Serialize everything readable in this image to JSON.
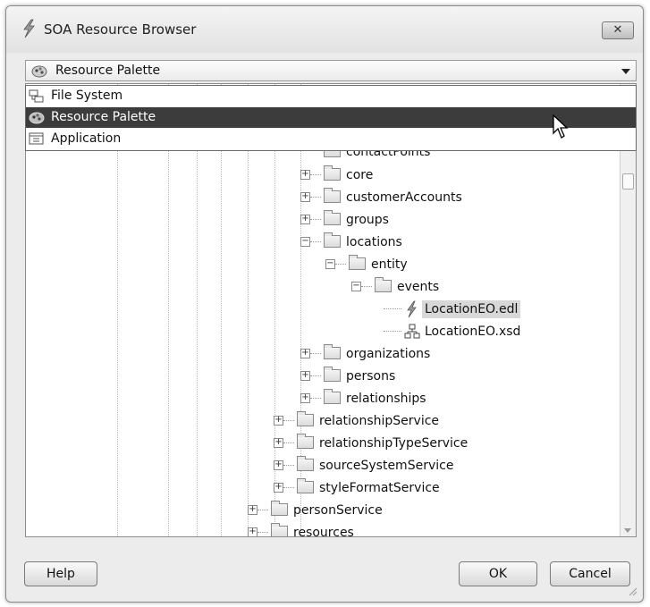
{
  "window": {
    "title": "SOA Resource Browser",
    "close_glyph": "✕"
  },
  "combo": {
    "selected": "Resource Palette"
  },
  "dropdown": {
    "options": [
      {
        "label": "File System",
        "icon": "file-system-icon"
      },
      {
        "label": "Resource Palette",
        "icon": "resource-palette-icon",
        "active": true
      },
      {
        "label": "Application",
        "icon": "application-icon"
      }
    ]
  },
  "tree": {
    "partial_top": "contactPoints",
    "rows": [
      {
        "label": "core"
      },
      {
        "label": "customerAccounts"
      },
      {
        "label": "groups"
      },
      {
        "label": "locations"
      },
      {
        "label": "entity"
      },
      {
        "label": "events"
      },
      {
        "label": "LocationEO.edl",
        "icon": "event-definition-icon",
        "selected": true
      },
      {
        "label": "LocationEO.xsd",
        "icon": "schema-icon"
      },
      {
        "label": "organizations"
      },
      {
        "label": "persons"
      },
      {
        "label": "relationships"
      },
      {
        "label": "relationshipService"
      },
      {
        "label": "relationshipTypeService"
      },
      {
        "label": "sourceSystemService"
      },
      {
        "label": "styleFormatService"
      },
      {
        "label": "personService"
      },
      {
        "label": "resources"
      }
    ]
  },
  "buttons": {
    "help": "Help",
    "ok": "OK",
    "cancel": "Cancel"
  },
  "colors": {
    "dropdown_active_bg": "#3c3c3c",
    "selected_item_bg": "#d8d8d8"
  }
}
